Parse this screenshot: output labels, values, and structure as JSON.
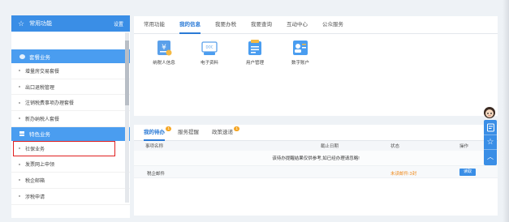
{
  "sidebar": {
    "header": {
      "title": "常用功能",
      "settings": "设置"
    },
    "section1": {
      "title": "套餐业务"
    },
    "section1_items": [
      "增量房交易套餐",
      "出口退税管理",
      "注销税费事项办理套餐",
      "新办纳税人套餐"
    ],
    "section2": {
      "title": "特色业务"
    },
    "section2_items": [
      "社保业务",
      "发票网上申领",
      "税企邮箱",
      "涉税申请"
    ]
  },
  "top_tabs": [
    "常用功能",
    "我的信息",
    "我要办税",
    "我要查询",
    "互动中心",
    "公众服务"
  ],
  "top_icons": [
    {
      "label": "纳税人信息",
      "icon": "taxpayer-info-icon"
    },
    {
      "label": "电子资料",
      "icon": "electronic-docs-icon"
    },
    {
      "label": "用户管理",
      "icon": "user-management-icon"
    },
    {
      "label": "数字账户",
      "icon": "digital-account-icon"
    }
  ],
  "bottom_tabs": [
    {
      "label": "我的待办",
      "badge": "1"
    },
    {
      "label": "服务提醒"
    },
    {
      "label": "政策速递",
      "badge": "1"
    }
  ],
  "table": {
    "headers": {
      "item": "事项名称",
      "deadline": "截止日期",
      "status": "状态",
      "action": "操作"
    },
    "notice": "该待办提醒结果仅供参考,如已经办理请忽略!",
    "rows": [
      {
        "item": "税企邮件",
        "deadline": "",
        "status": "未读邮件:3封",
        "action": "读取"
      }
    ]
  },
  "colors": {
    "accent": "#3a8ee6",
    "active_tab": "#2a7ad6",
    "warning": "#f08a1c",
    "highlight_border": "#e02020"
  }
}
